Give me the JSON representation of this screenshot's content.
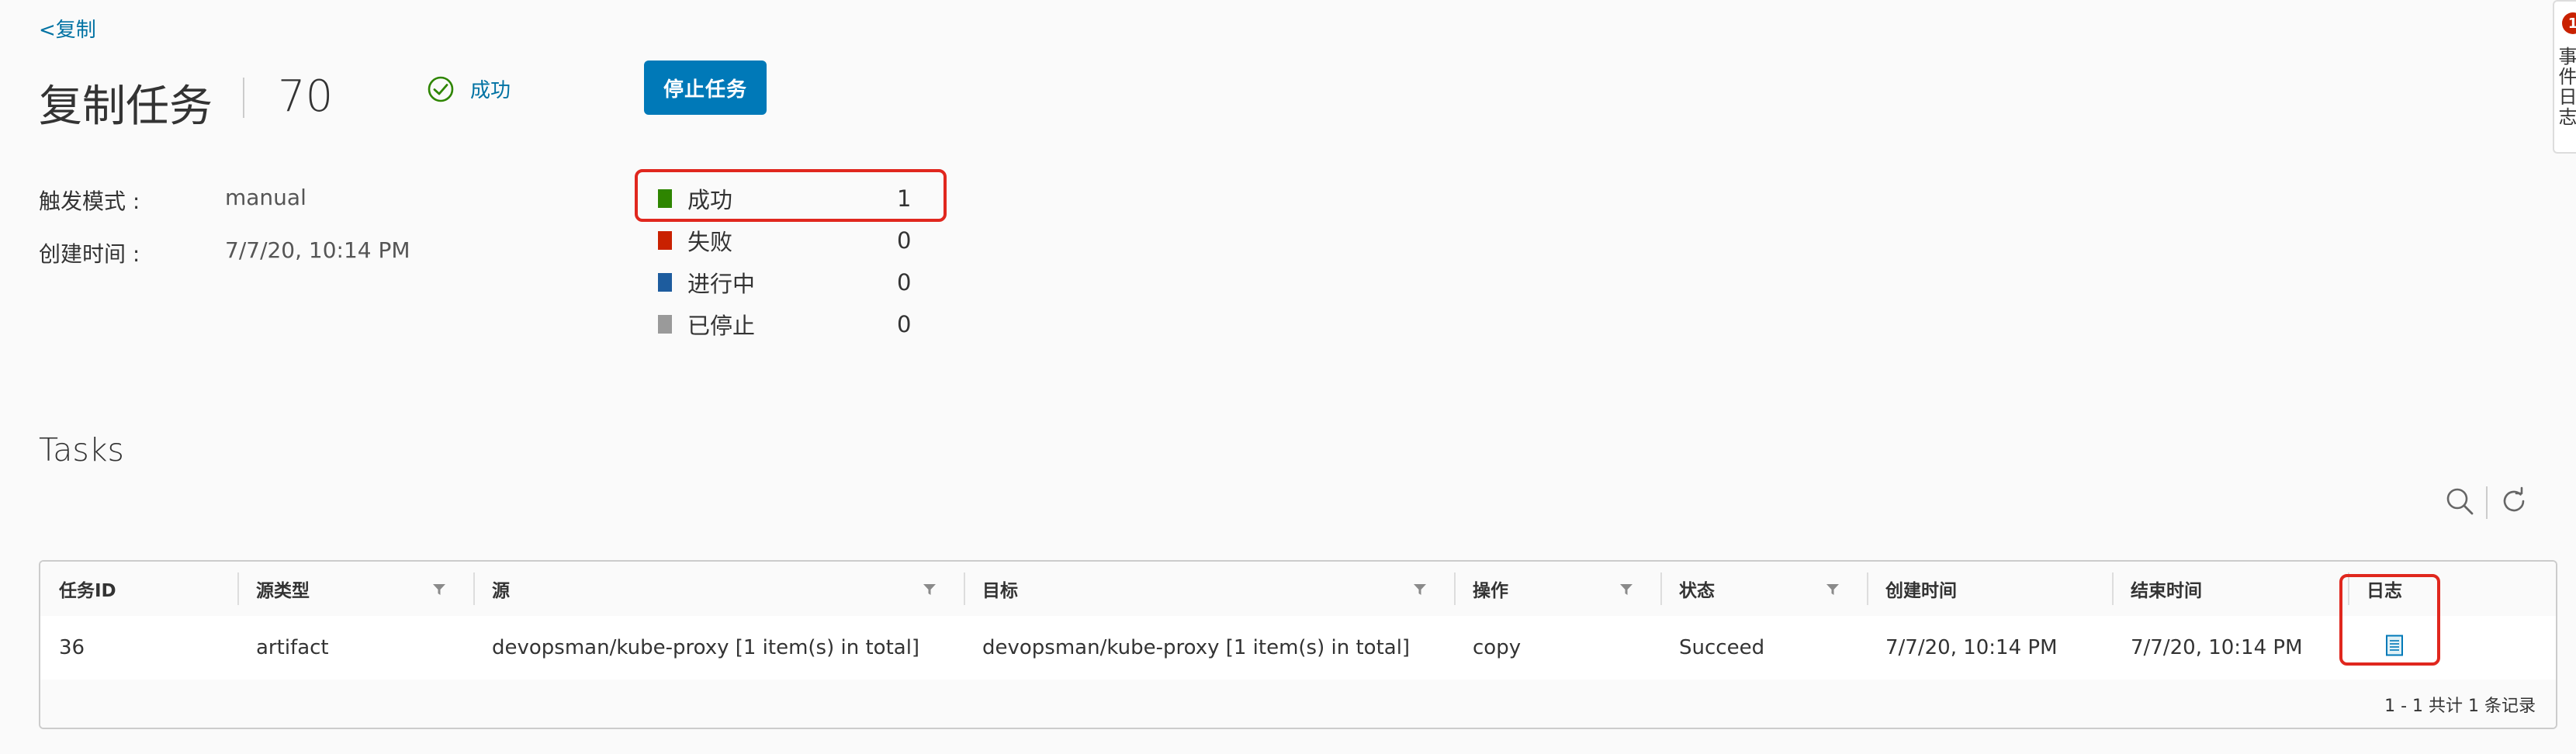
{
  "breadcrumb": {
    "back_label": "<复制"
  },
  "header": {
    "title": "复制任务",
    "job_id": "70",
    "status_label": "成功",
    "stop_button": "停止任务"
  },
  "info": {
    "trigger_label": "触发模式 :",
    "trigger_value": "manual",
    "created_label": "创建时间 :",
    "created_value": "7/7/20, 10:14 PM"
  },
  "summary": [
    {
      "label": "成功",
      "count": "1",
      "color": "#2e8500"
    },
    {
      "label": "失败",
      "count": "0",
      "color": "#c92100"
    },
    {
      "label": "进行中",
      "count": "0",
      "color": "#1d5c9e"
    },
    {
      "label": "已停止",
      "count": "0",
      "color": "#9a9a9a"
    }
  ],
  "tasks": {
    "title": "Tasks",
    "toolbar_icons": [
      "search-icon",
      "refresh-icon"
    ],
    "columns": [
      {
        "label": "任务ID",
        "filter": false
      },
      {
        "label": "源类型",
        "filter": true
      },
      {
        "label": "源",
        "filter": true
      },
      {
        "label": "目标",
        "filter": true
      },
      {
        "label": "操作",
        "filter": true
      },
      {
        "label": "状态",
        "filter": true
      },
      {
        "label": "创建时间",
        "filter": false
      },
      {
        "label": "结束时间",
        "filter": false
      },
      {
        "label": "日志",
        "filter": false
      }
    ],
    "rows": [
      {
        "id": "36",
        "source_type": "artifact",
        "source": "devopsman/kube-proxy [1 item(s) in total]",
        "target": "devopsman/kube-proxy [1 item(s) in total]",
        "operation": "copy",
        "status": "Succeed",
        "created": "7/7/20, 10:14 PM",
        "ended": "7/7/20, 10:14 PM",
        "log_icon": "log-file-icon"
      }
    ],
    "footer": "1 - 1 共计 1 条记录"
  },
  "drawer": {
    "badge": "1",
    "label": "事件日志"
  },
  "colors": {
    "accent": "#0079b8",
    "link": "#0072a3",
    "highlight": "#e0271e"
  }
}
